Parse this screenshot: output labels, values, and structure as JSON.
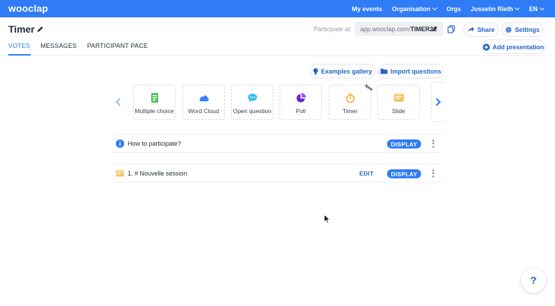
{
  "colors": {
    "brand": "#2f7cf6",
    "link": "#2563c9"
  },
  "topbar": {
    "logo": "wooclap",
    "nav": [
      {
        "label": "My events",
        "dropdown": false
      },
      {
        "label": "Organisation",
        "dropdown": true
      },
      {
        "label": "Orgs",
        "dropdown": false
      },
      {
        "label": "Josselin Rieth",
        "dropdown": true
      },
      {
        "label": "EN",
        "dropdown": true
      }
    ]
  },
  "header": {
    "title": "Timer",
    "participate_label": "Participate at:",
    "url_prefix": "app.wooclap.com/",
    "url_code": "TIMER23",
    "share_label": "Share",
    "settings_label": "Settings"
  },
  "tabs": [
    {
      "label": "VOTES",
      "active": true
    },
    {
      "label": "MESSAGES",
      "active": false
    },
    {
      "label": "PARTICIPANT PACE",
      "active": false
    }
  ],
  "add_presentation_label": "Add presentation",
  "gallery_label": "Examples gallery",
  "import_label": "Import questions",
  "question_types": [
    {
      "label": "Multiple choice",
      "icon": "multiple-choice-icon"
    },
    {
      "label": "Word Cloud",
      "icon": "cloud-icon"
    },
    {
      "label": "Open question",
      "icon": "speech-bubble-icon"
    },
    {
      "label": "Poll",
      "icon": "pie-chart-icon"
    },
    {
      "label": "Timer",
      "icon": "stopwatch-icon",
      "badge": "New"
    },
    {
      "label": "Slide",
      "icon": "slide-icon"
    }
  ],
  "rows": [
    {
      "text": "How to participate?",
      "icon": "info-icon",
      "display_label": "DISPLAY"
    },
    {
      "text": "1.  # Nouvelle session",
      "icon": "slide-icon",
      "edit_label": "EDIT",
      "display_label": "DISPLAY"
    }
  ],
  "help_label": "?"
}
